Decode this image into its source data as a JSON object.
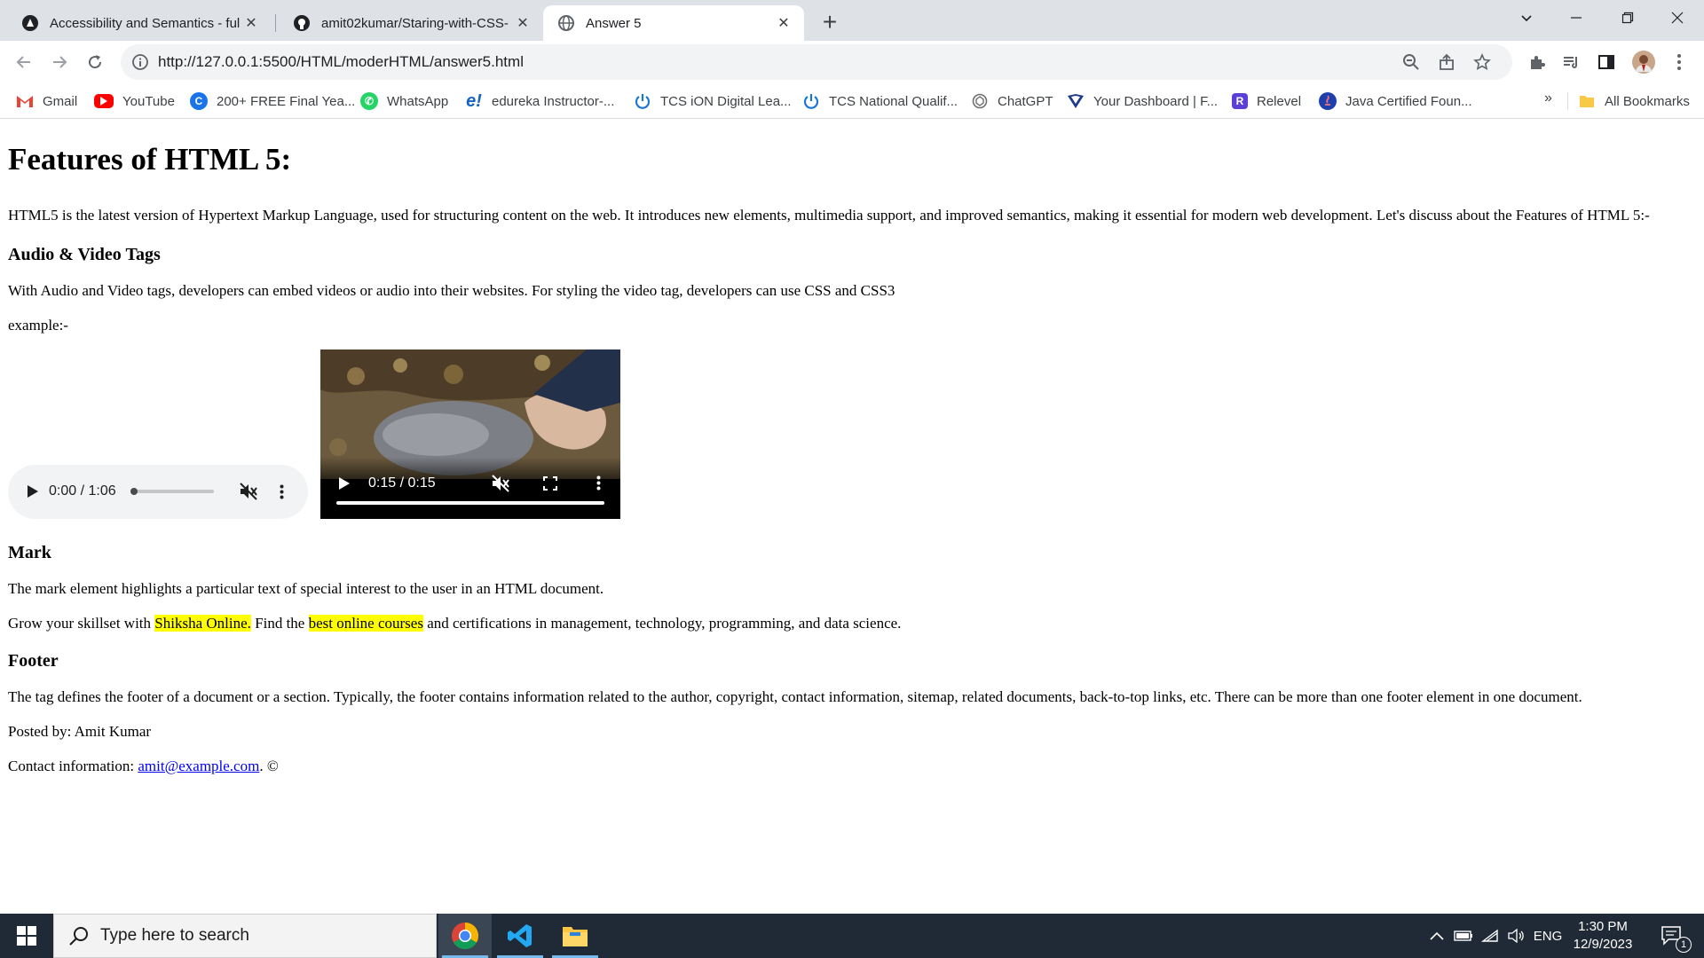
{
  "browser": {
    "tabs": [
      {
        "title": "Accessibility and Semantics - ful",
        "icon": "site-dark-icon"
      },
      {
        "title": "amit02kumar/Staring-with-CSS-",
        "icon": "github-icon"
      },
      {
        "title": "Answer 5",
        "icon": "globe-icon",
        "active": true
      }
    ],
    "url": "http://127.0.0.1:5500/HTML/moderHTML/answer5.html",
    "bookmarks": [
      {
        "label": "Gmail",
        "icon": "gmail-icon",
        "color": "#ea4335"
      },
      {
        "label": "YouTube",
        "icon": "youtube-icon",
        "color": "#ff0000"
      },
      {
        "label": "200+ FREE Final Yea...",
        "icon": "c-logo-icon",
        "color": "#1a73e8"
      },
      {
        "label": "WhatsApp",
        "icon": "whatsapp-icon",
        "color": "#25d366"
      },
      {
        "label": "edureka Instructor-...",
        "icon": "edureka-icon",
        "color": "#1565c0"
      },
      {
        "label": "TCS iON Digital Lea...",
        "icon": "power-icon",
        "color": "#1976d2"
      },
      {
        "label": "TCS National Qualif...",
        "icon": "power-icon",
        "color": "#1976d2"
      },
      {
        "label": "ChatGPT",
        "icon": "chatgpt-icon",
        "color": "#6e6e6e"
      },
      {
        "label": "Your Dashboard | F...",
        "icon": "dashboard-icon",
        "color": "#1e3a8a"
      },
      {
        "label": "Relevel",
        "icon": "relevel-icon",
        "color": "#5b3fd6"
      },
      {
        "label": "Java Certified Foun...",
        "icon": "java-icon",
        "color": "#e11d48"
      }
    ],
    "all_bookmarks_label": "All Bookmarks"
  },
  "page": {
    "title": "Features of HTML 5:",
    "intro": "HTML5 is the latest version of Hypertext Markup Language, used for structuring content on the web. It introduces new elements, multimedia support, and improved semantics, making it essential for modern web development. Let's discuss about the Features of HTML 5:-",
    "av_heading": "Audio & Video Tags",
    "av_text": "With Audio and Video tags, developers can embed videos or audio into their websites. For styling the video tag, developers can use CSS and CSS3",
    "example_label": "example:-",
    "audio_time": "0:00 / 1:06",
    "audio_progress": 0.0,
    "video_time": "0:15 / 0:15",
    "video_progress": 1.0,
    "mark_heading": "Mark",
    "mark_text": "The mark element highlights a particular text of special interest to the user in an HTML document.",
    "mark_sentence": {
      "before": "Grow your skillset with ",
      "highlight1": "Shiksha Online.",
      "middle": " Find the ",
      "highlight2": "best online courses",
      "after": " and certifications in management, technology, programming, and data science."
    },
    "footer_heading": "Footer",
    "footer_text": "The tag defines the footer of a document or a section. Typically, the footer contains information related to the author, copyright, contact information, sitemap, related documents, back-to-top links, etc. There can be more than one footer element in one document.",
    "posted_by": "Posted by: Amit Kumar",
    "contact_prefix": "Contact information: ",
    "contact_email": "amit@example.com",
    "contact_suffix": ". ©"
  },
  "taskbar": {
    "search_placeholder": "Type here to search",
    "language": "ENG",
    "time": "1:30 PM",
    "date": "12/9/2023",
    "notification_count": "1",
    "accent": "#76b9ed"
  }
}
